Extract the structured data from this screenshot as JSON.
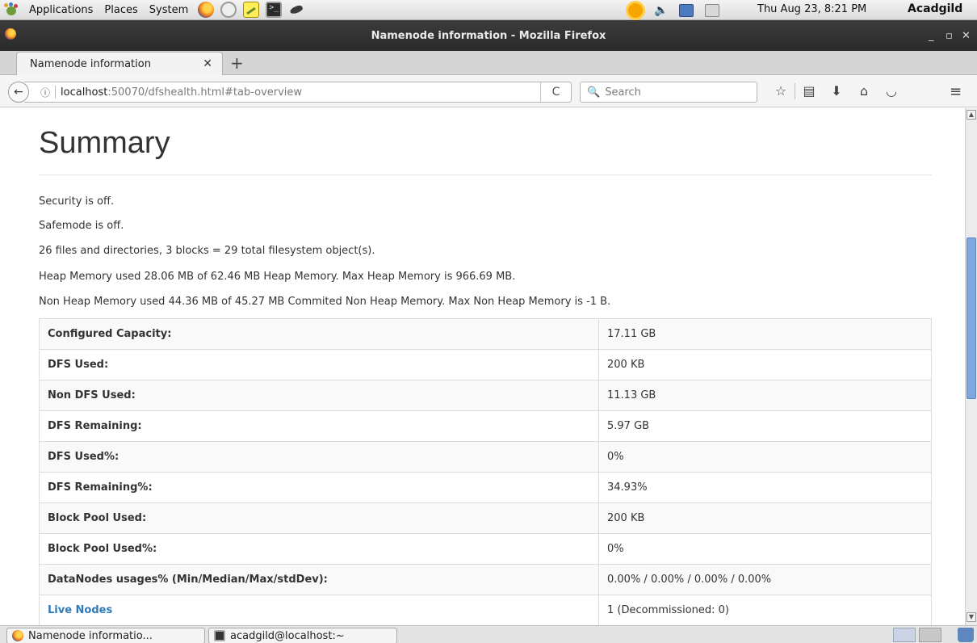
{
  "top_panel": {
    "menus": [
      "Applications",
      "Places",
      "System"
    ],
    "clock": "Thu Aug 23,  8:21 PM",
    "user": "Acadgild"
  },
  "window": {
    "title": "Namenode information - Mozilla Firefox",
    "controls": [
      "_",
      "▫",
      "✕"
    ]
  },
  "tabs": [
    {
      "label": "Namenode information",
      "close": "✕"
    }
  ],
  "newtab": "+",
  "navbar": {
    "back": "←",
    "info": "ⓘ",
    "url_host": "localhost",
    "url_rest": ":50070/dfshealth.html#tab-overview",
    "reload": "C",
    "search_placeholder": "Search"
  },
  "content": {
    "heading": "Summary",
    "lines": [
      "Security is off.",
      "Safemode is off.",
      "26 files and directories, 3 blocks = 29 total filesystem object(s).",
      "Heap Memory used 28.06 MB of 62.46 MB Heap Memory. Max Heap Memory is 966.69 MB.",
      "Non Heap Memory used 44.36 MB of 45.27 MB Commited Non Heap Memory. Max Non Heap Memory is -1 B."
    ],
    "rows": [
      {
        "key": "Configured Capacity:",
        "value": "17.11 GB"
      },
      {
        "key": "DFS Used:",
        "value": "200 KB"
      },
      {
        "key": "Non DFS Used:",
        "value": "11.13 GB"
      },
      {
        "key": "DFS Remaining:",
        "value": "5.97 GB"
      },
      {
        "key": "DFS Used%:",
        "value": "0%"
      },
      {
        "key": "DFS Remaining%:",
        "value": "34.93%"
      },
      {
        "key": "Block Pool Used:",
        "value": "200 KB"
      },
      {
        "key": "Block Pool Used%:",
        "value": "0%"
      },
      {
        "key": "DataNodes usages% (Min/Median/Max/stdDev):",
        "value": "0.00% / 0.00% / 0.00% / 0.00%"
      },
      {
        "key": "Live Nodes",
        "value": "1 (Decommissioned: 0)"
      }
    ]
  },
  "taskbar": {
    "items": [
      "Namenode informatio...",
      "acadgild@localhost:~"
    ]
  },
  "colors": {
    "link": "#2f7ab9",
    "titlebar": "#2e2e2e",
    "scroll_thumb": "#7ea7de"
  }
}
